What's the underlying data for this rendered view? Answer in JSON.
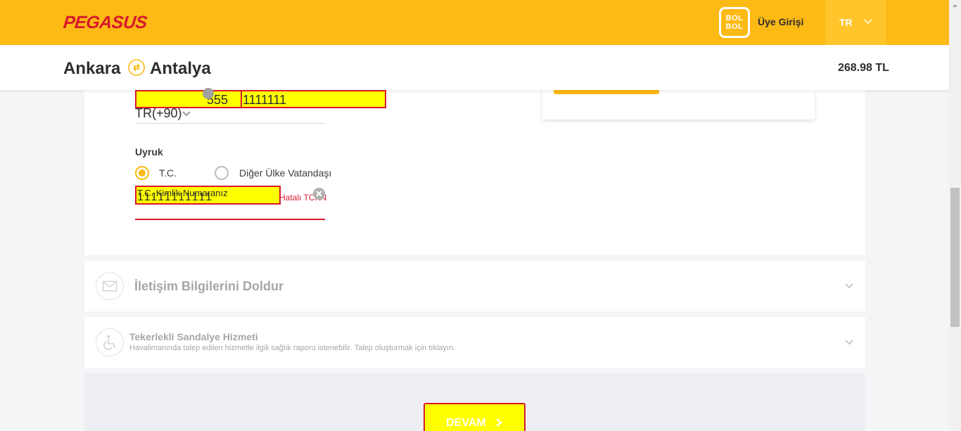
{
  "header": {
    "logo_text": "PEGASUS",
    "bolbol_line1": "BOL",
    "bolbol_line2": "BOL",
    "login_label": "Üye Girişi",
    "language": "TR"
  },
  "route": {
    "from": "Ankara",
    "to": "Antalya",
    "price": "268.98 TL"
  },
  "form": {
    "phone_code": "555",
    "phone_number": "1111111",
    "country_code": "TR(+90)",
    "nationality_label": "Uyruk",
    "nationality_options": [
      "T.C.",
      "Diğer Ülke Vatandaşı"
    ],
    "nationality_selected": "T.C.",
    "tc_label": "T.C. Kimlik Numaranız",
    "tc_value": "11111111111",
    "tc_error": "Hatalı TCKN"
  },
  "accordions": {
    "contact_title": "İletişim Bilgilerini Doldur",
    "wheelchair_title": "Tekerlekli Sandalye Hizmeti",
    "wheelchair_sub": "Havalimanında talep edilen hizmetle ilgili sağlık raporu istenebilir. Talep oluşturmak için tıklayın."
  },
  "actions": {
    "continue_label": "DEVAM"
  },
  "colors": {
    "brand_yellow": "#fdb914",
    "brand_red": "#d7192d",
    "highlight": "#ffff00"
  }
}
